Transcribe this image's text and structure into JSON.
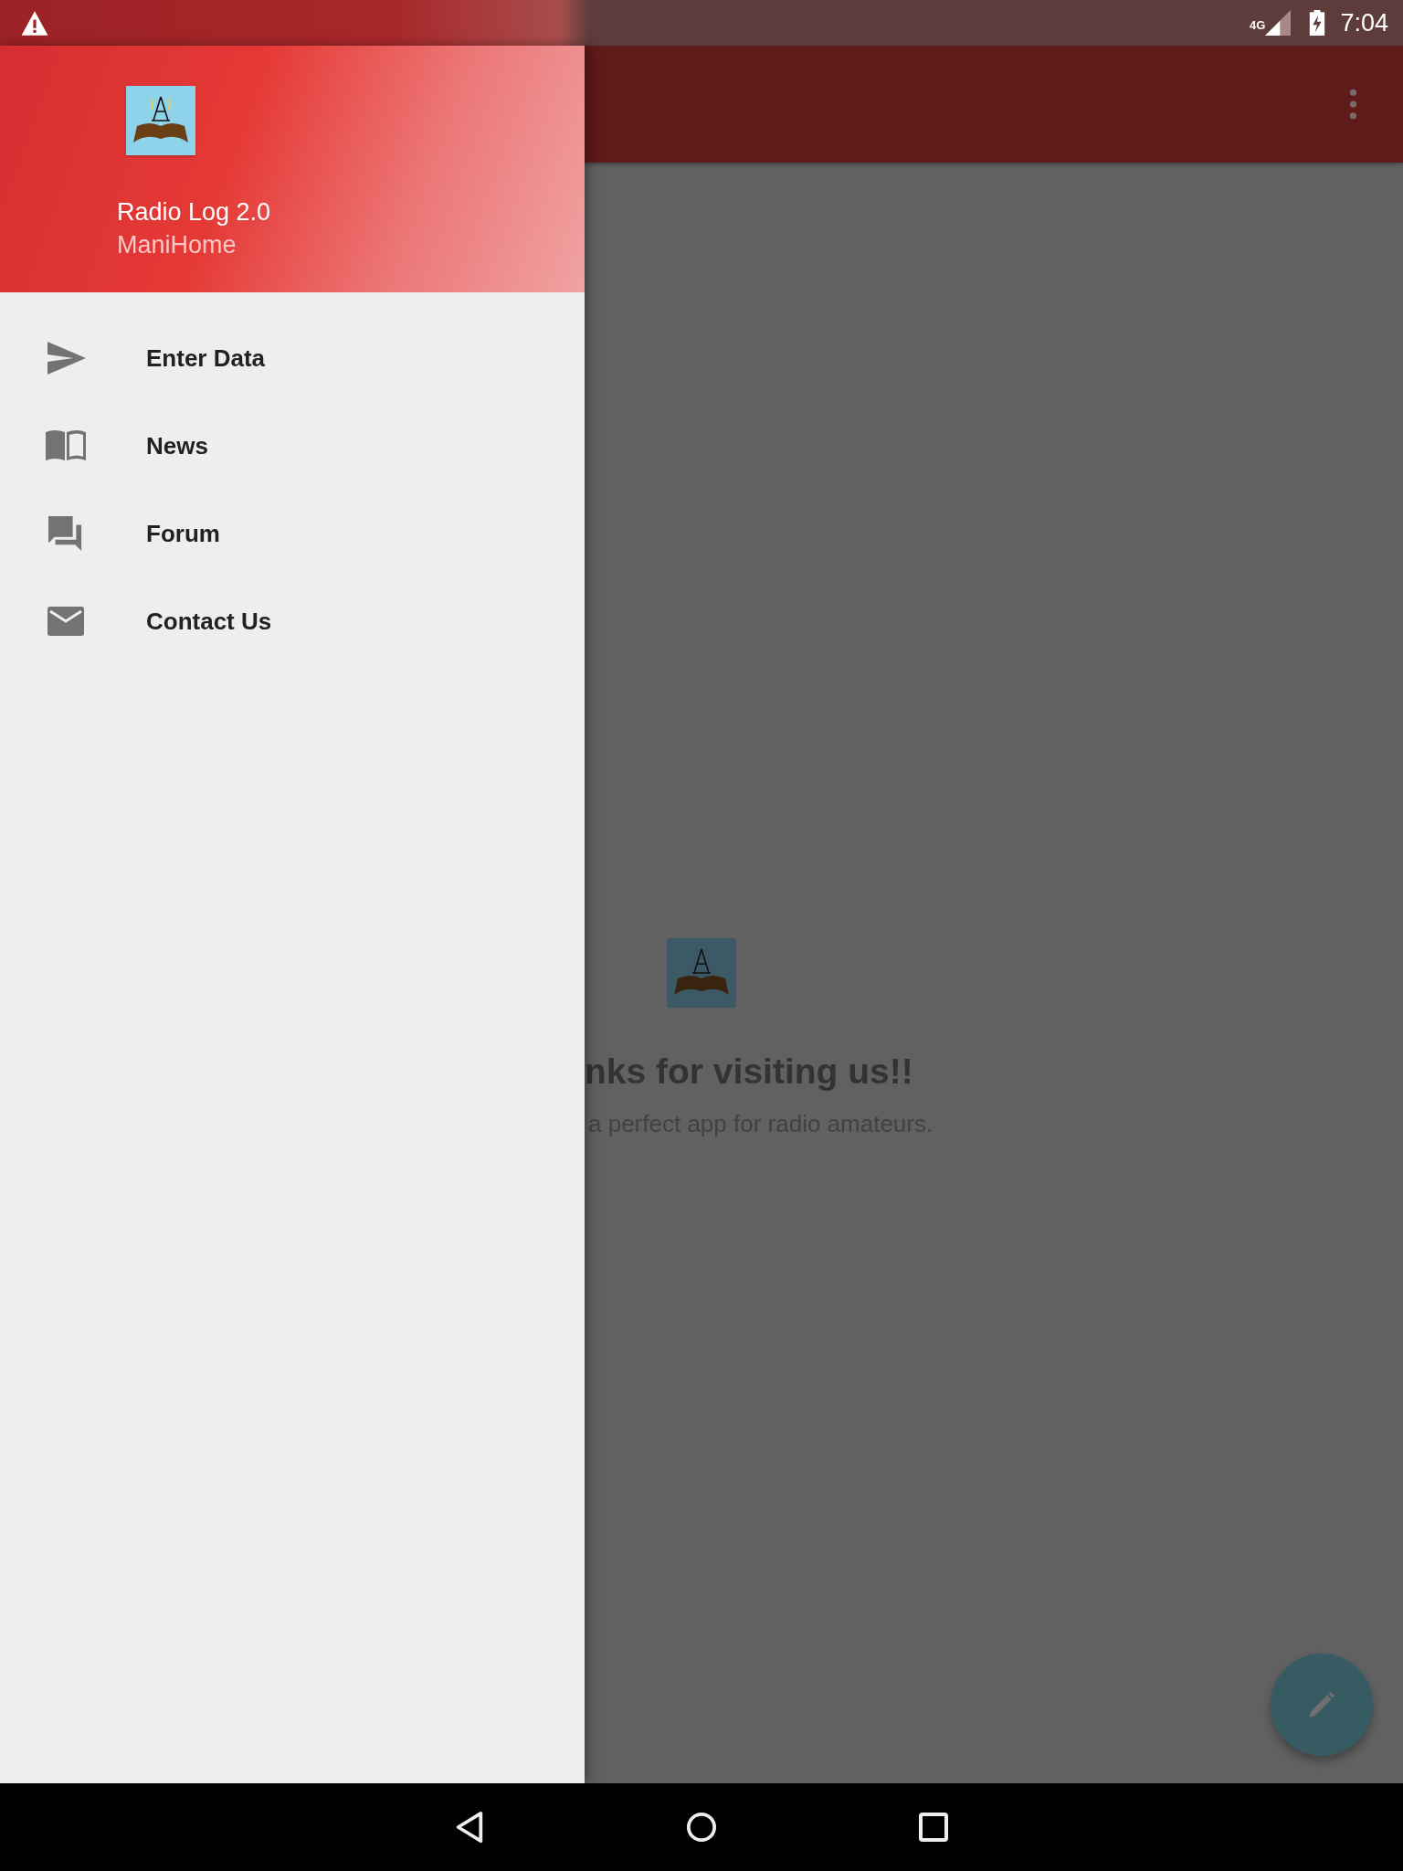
{
  "status_bar": {
    "time": "7:04",
    "network": "4G"
  },
  "drawer": {
    "app_name": "Radio Log 2.0",
    "account": "ManiHome",
    "items": [
      {
        "kind": "send",
        "label": "Enter Data"
      },
      {
        "kind": "book",
        "label": "News"
      },
      {
        "kind": "forum",
        "label": "Forum"
      },
      {
        "kind": "mail",
        "label": "Contact Us"
      }
    ]
  },
  "content": {
    "heading": "nks for visiting us!!",
    "subtitle": "a perfect app for radio amateurs."
  }
}
